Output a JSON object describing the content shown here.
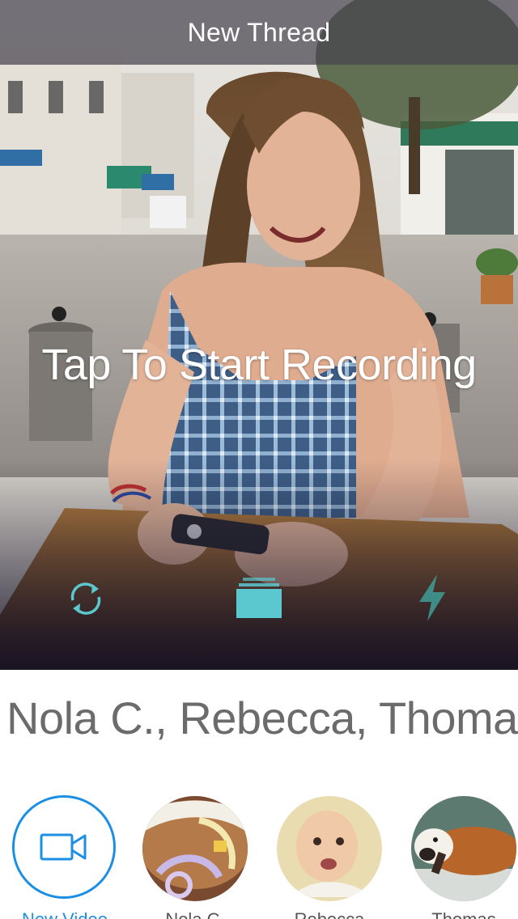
{
  "nav": {
    "title": "New Thread"
  },
  "preview": {
    "prompt": "Tap To Start Recording"
  },
  "controls": {
    "switch_icon": "switch-camera-icon",
    "gallery_icon": "gallery-icon",
    "flash_icon": "flash-icon",
    "accent_color": "#5bc8cf"
  },
  "recipients": {
    "text": "Nola C., Rebecca, Thomas"
  },
  "contacts": [
    {
      "name": "New Video",
      "icon": "video-camera-icon",
      "color": "#1a8fe3"
    },
    {
      "name": "Nola C."
    },
    {
      "name": "Rebecca"
    },
    {
      "name": "Thomas"
    }
  ]
}
